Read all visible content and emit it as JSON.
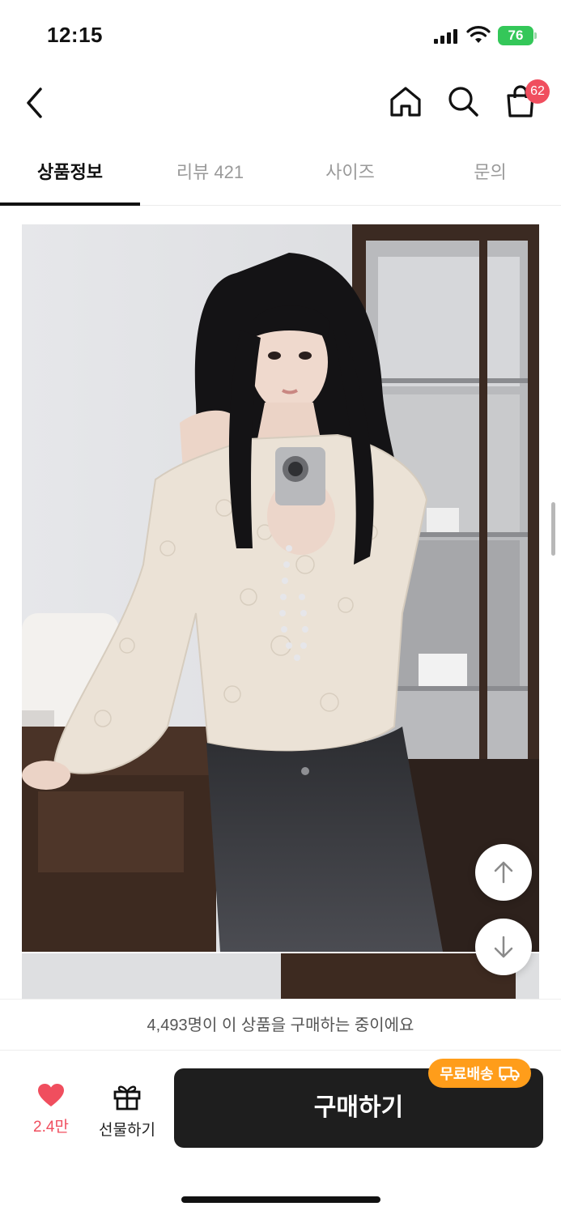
{
  "status_bar": {
    "time": "12:15",
    "battery": "76",
    "icons": [
      "signal-icon",
      "wifi-icon",
      "battery-icon"
    ]
  },
  "nav": {
    "icons": [
      "back-chevron-icon",
      "home-icon",
      "search-icon",
      "shopping-bag-icon"
    ],
    "cart_badge": "62"
  },
  "tabs": [
    {
      "label": "상품정보",
      "active": true
    },
    {
      "label": "리뷰 421",
      "active": false
    },
    {
      "label": "사이즈",
      "active": false
    },
    {
      "label": "문의",
      "active": false
    }
  ],
  "product_image": {
    "subject": "model in cream lace off-shoulder top with compact camera",
    "icons": [
      "arrow-up-icon",
      "arrow-down-icon"
    ]
  },
  "purchase_notice": "4,493명이 이 상품을 구매하는 중이에요",
  "bottom_bar": {
    "like_count": "2.4만",
    "gift_label": "선물하기",
    "buy_label": "구매하기",
    "shipping_badge": "무료배송",
    "icons": [
      "heart-icon",
      "gift-icon",
      "truck-icon"
    ]
  },
  "colors": {
    "accent_red": "#f04e5e",
    "buy_button": "#1e1e1e",
    "shipping_badge": "#ff9d1a",
    "battery_green": "#34c759"
  }
}
